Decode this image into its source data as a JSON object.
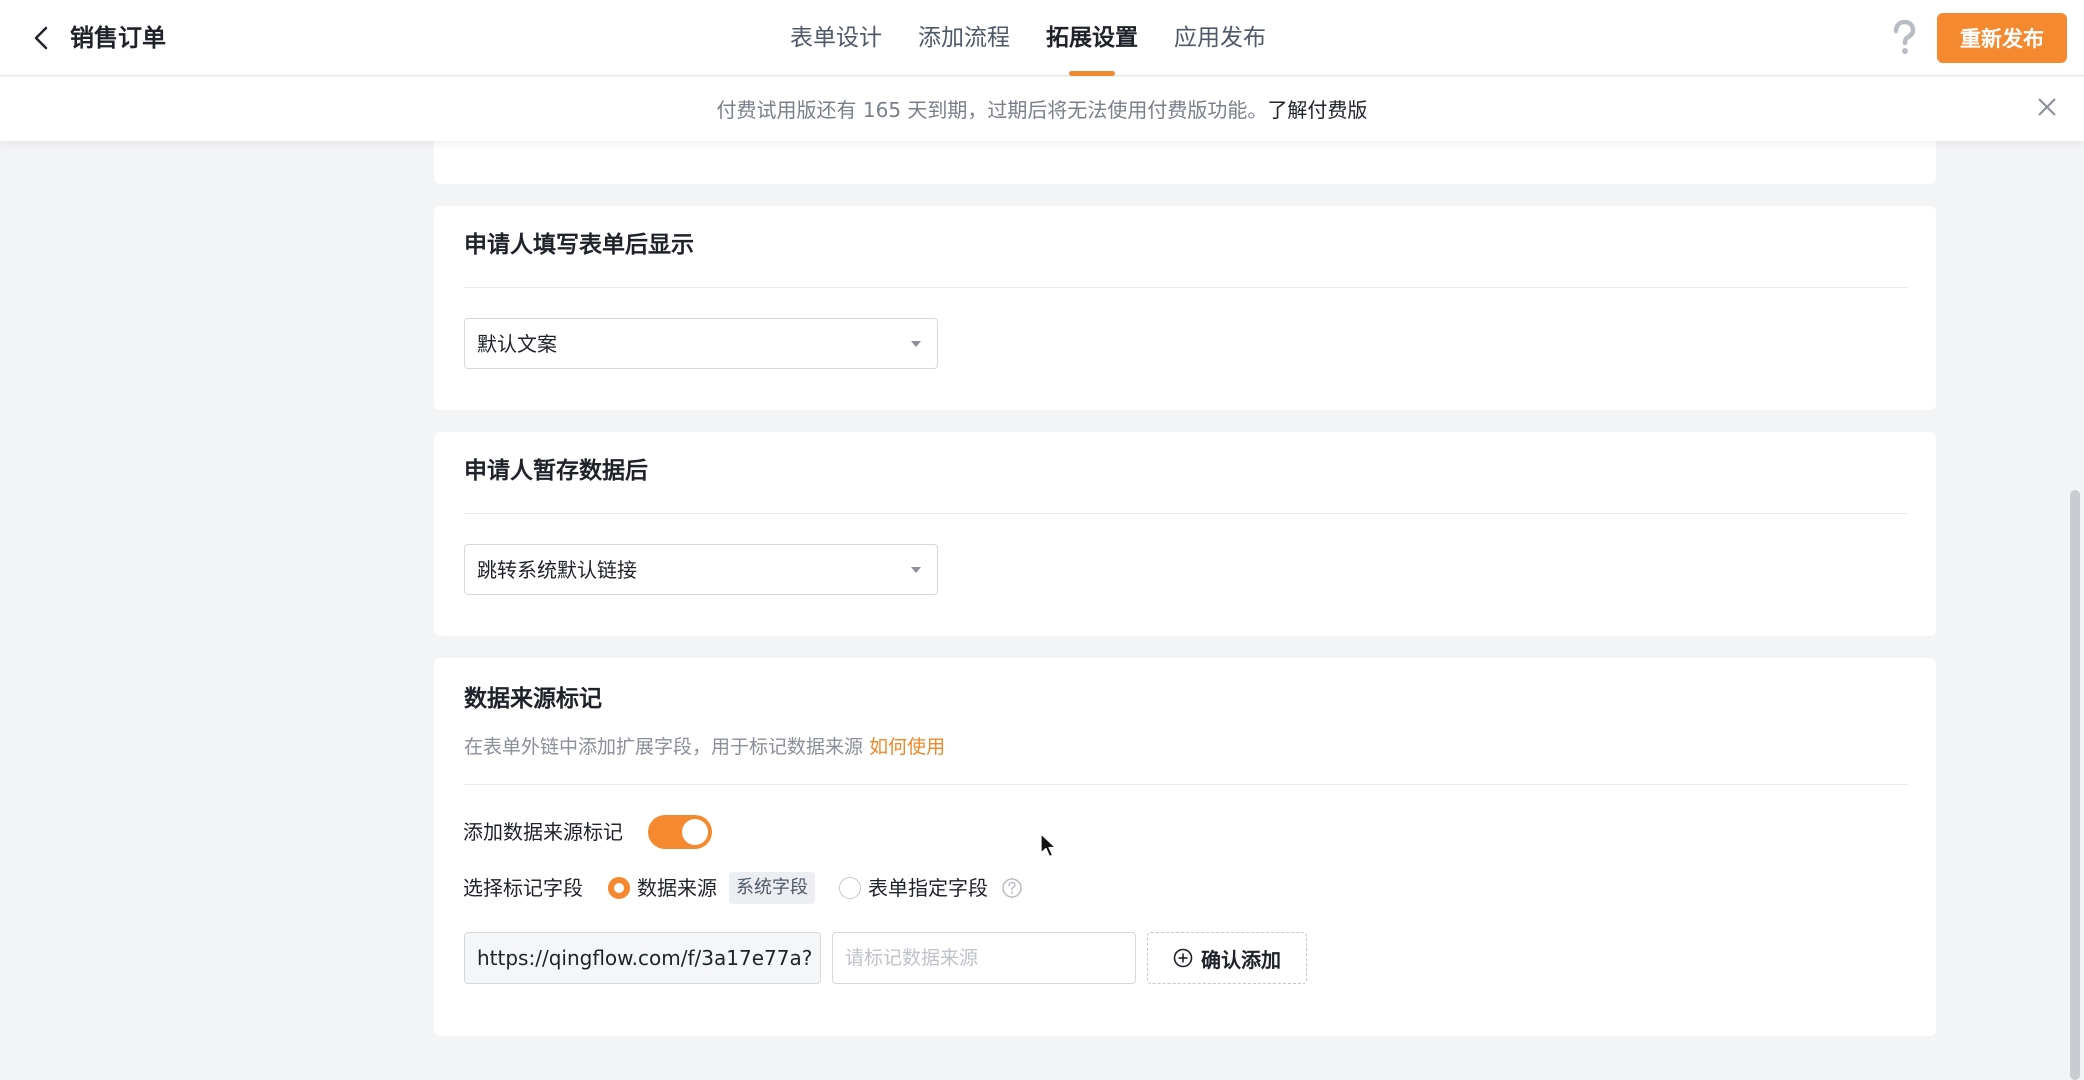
{
  "header": {
    "title": "销售订单",
    "tabs": [
      {
        "label": "表单设计",
        "active": false
      },
      {
        "label": "添加流程",
        "active": false
      },
      {
        "label": "拓展设置",
        "active": true
      },
      {
        "label": "应用发布",
        "active": false
      }
    ],
    "republish_label": "重新发布"
  },
  "notice": {
    "text": "付费试用版还有 165 天到期，过期后将无法使用付费版功能。",
    "link": "了解付费版"
  },
  "after_submit": {
    "title": "申请人填写表单后显示",
    "select_value": "默认文案"
  },
  "after_draft": {
    "title": "申请人暂存数据后",
    "select_value": "跳转系统默认链接"
  },
  "source_mark": {
    "title": "数据来源标记",
    "description": "在表单外链中添加扩展字段，用于标记数据来源",
    "how_to_link": "如何使用",
    "toggle_label": "添加数据来源标记",
    "toggle_on": true,
    "field_label": "选择标记字段",
    "option_source": "数据来源",
    "system_tag": "系统字段",
    "option_form_field": "表单指定字段",
    "url_value": "https://qingflow.com/f/3a17e77a? ...",
    "input_placeholder": "请标记数据来源",
    "confirm_label": "确认添加"
  },
  "colors": {
    "accent": "#f5892f",
    "link": "#f0882a"
  }
}
